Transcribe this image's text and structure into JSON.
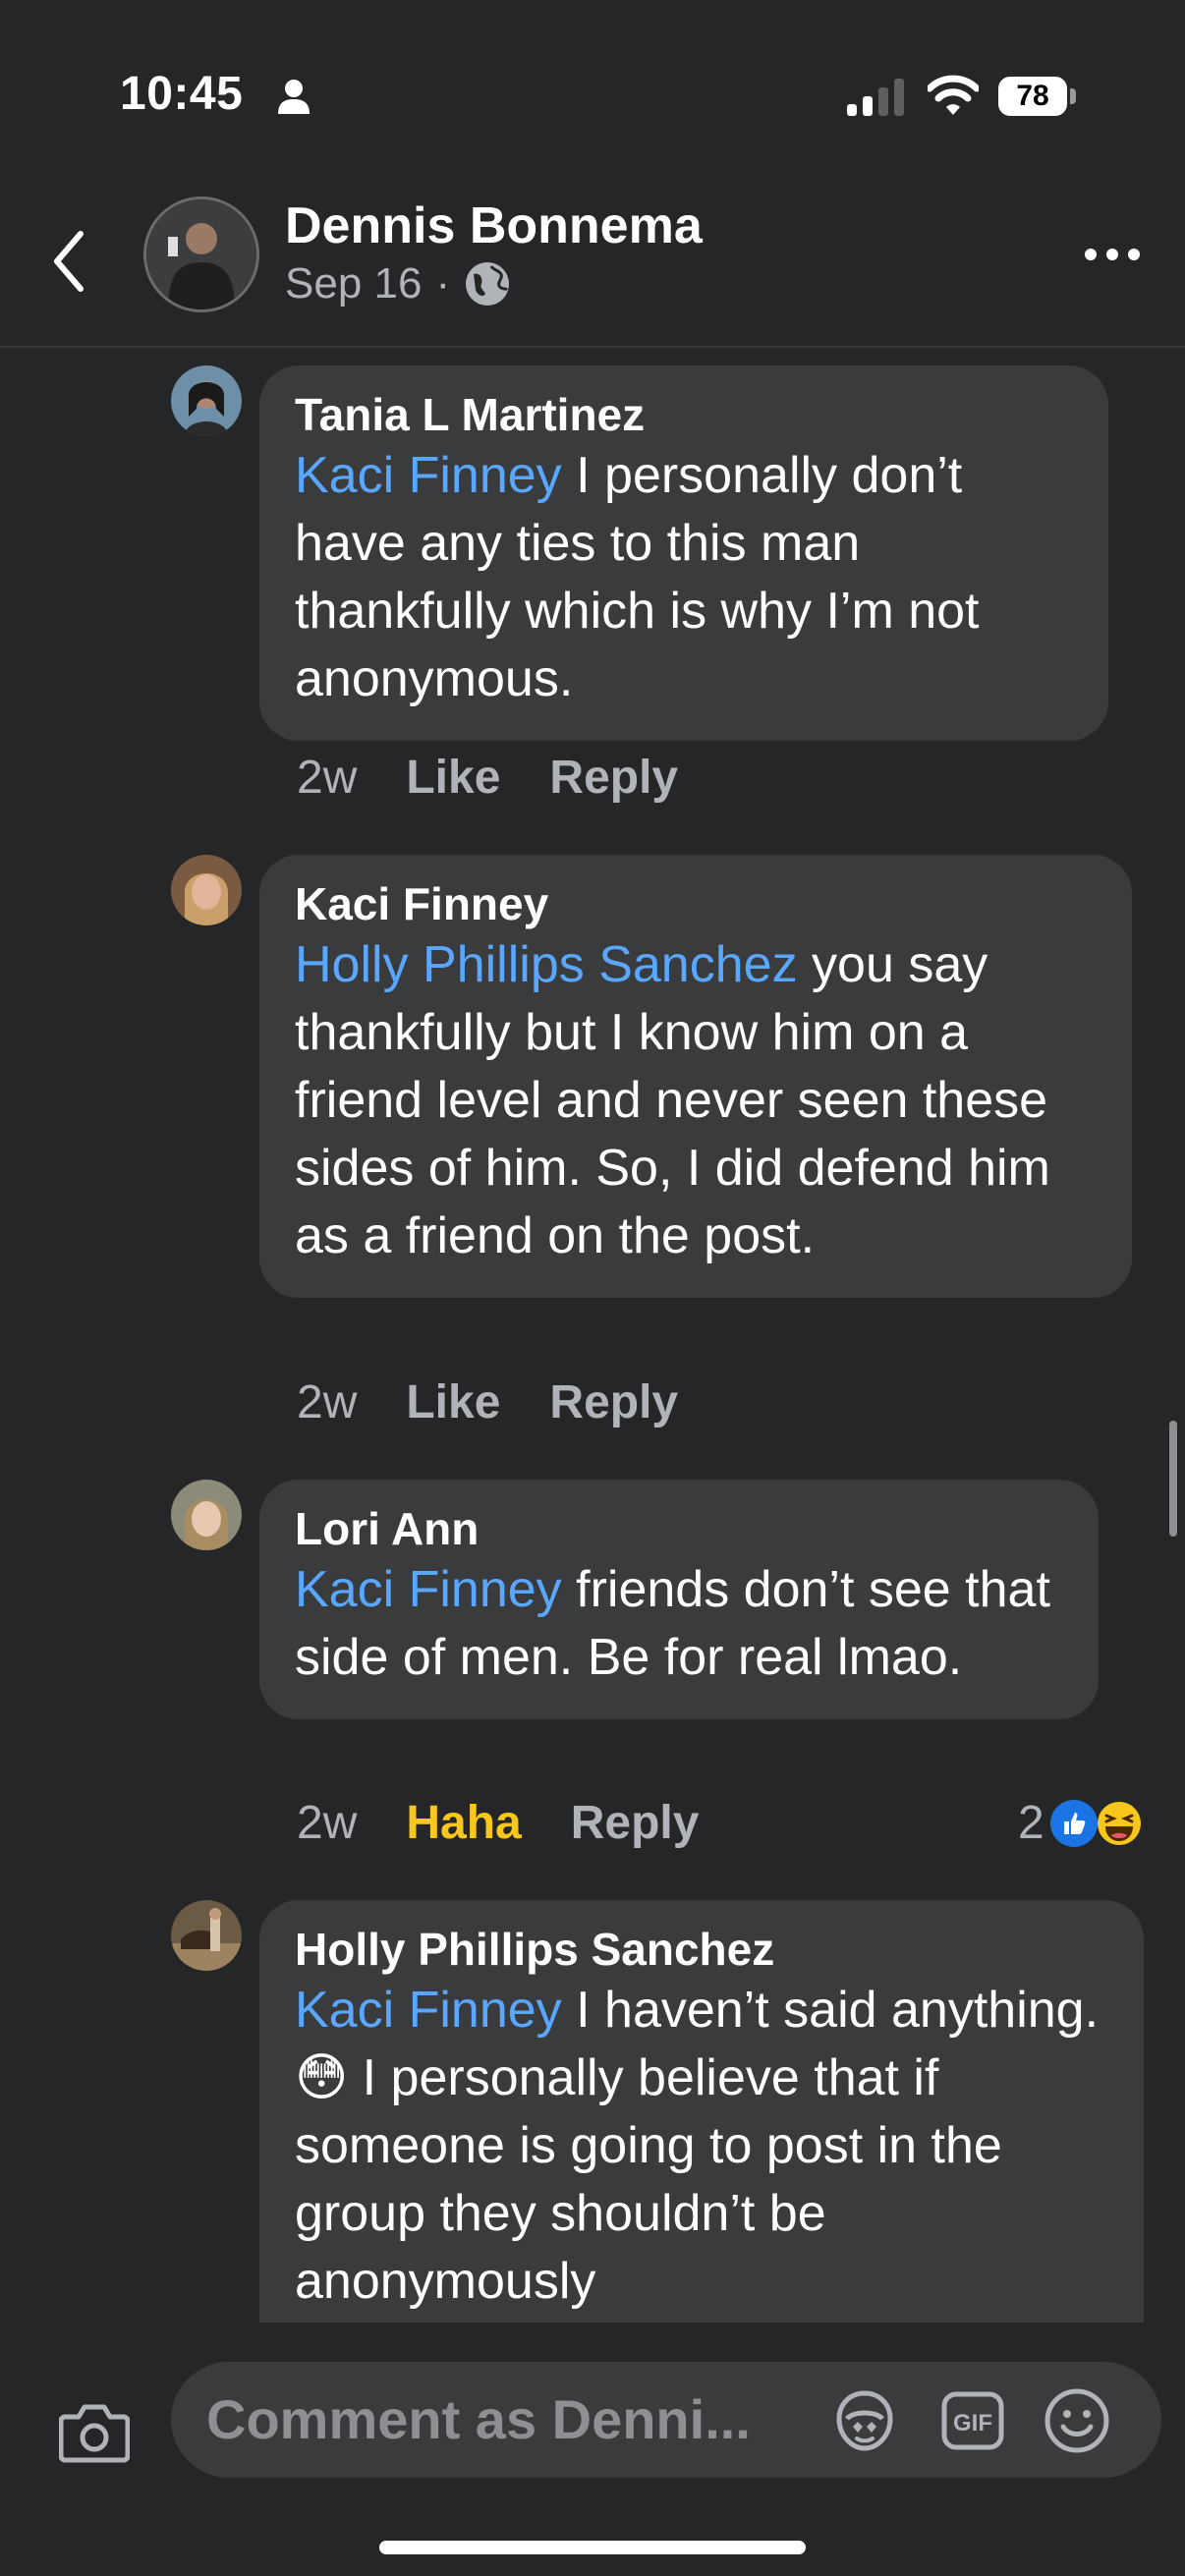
{
  "status_bar": {
    "time": "10:45",
    "battery": "78"
  },
  "header": {
    "author": "Dennis Bonnema",
    "date": "Sep 16",
    "separator": "·"
  },
  "comments": [
    {
      "name": "Tania L Martinez",
      "mention": "Kaci Finney",
      "text": " I personally don’t have any ties to this man thankfully which is why I’m not anonymous.",
      "time": "2w",
      "like_label": "Like",
      "reply_label": "Reply"
    },
    {
      "name": "Kaci Finney",
      "mention": "Holly Phillips Sanchez",
      "text": " you say thankfully but I know him on a friend level and never seen these sides of him. So, I did defend him as a friend on the post.",
      "time": "2w",
      "like_label": "Like",
      "reply_label": "Reply"
    },
    {
      "name": "Lori Ann",
      "mention": "Kaci Finney",
      "text": " friends don’t see that side of men. Be for real lmao.",
      "time": "2w",
      "like_label": "Haha",
      "reply_label": "Reply",
      "reaction_count": "2"
    },
    {
      "name": "Holly Phillips Sanchez",
      "mention": "Kaci Finney",
      "text": " I haven’t said anything.😳 I personally believe that if someone is going to post in the group they shouldn’t be anonymously",
      "time": "",
      "like_label": "",
      "reply_label": ""
    }
  ],
  "composer": {
    "placeholder": "Comment as Denni..."
  },
  "colors": {
    "background": "#252628",
    "bubble": "#3a3b3d",
    "mention": "#5aa7ff",
    "haha": "#f7c71c",
    "meta": "#b0b3b8"
  },
  "icons": [
    "back-icon",
    "more-icon",
    "globe-icon",
    "camera-icon",
    "avatar-sticker-icon",
    "gif-icon",
    "emoji-icon",
    "like-reaction-icon",
    "haha-reaction-icon"
  ]
}
